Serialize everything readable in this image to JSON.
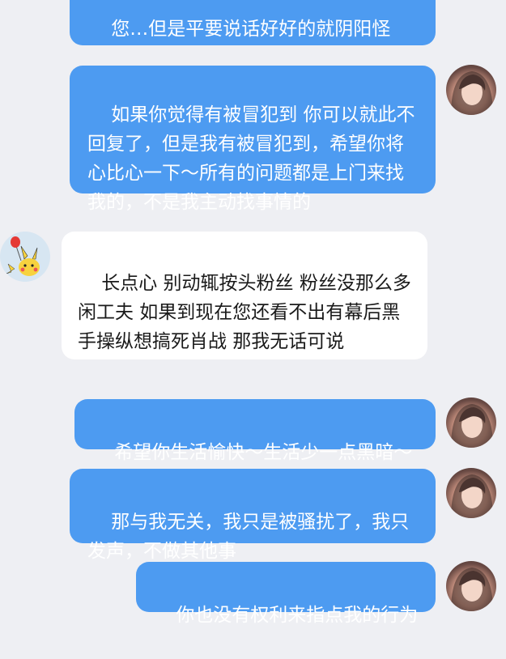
{
  "messages": [
    {
      "side": "out",
      "text": "您…但是平要说话好好的就阴阳怪气，挺让人不舒服的"
    },
    {
      "side": "out",
      "text": "如果你觉得有被冒犯到 你可以就此不回复了，但是我有被冒犯到，希望你将心比心一下～所有的问题都是上门来找我的，不是我主动找事情的"
    },
    {
      "side": "in",
      "text": "长点心 别动辄按头粉丝 粉丝没那么多闲工夫 如果到现在您还看不出有幕后黑手操纵想搞死肖战 那我无话可说"
    },
    {
      "side": "out",
      "text": "希望你生活愉快～生活少一点黑暗～"
    },
    {
      "side": "out",
      "text": "那与我无关，我只是被骚扰了，我只发声，不做其他事"
    },
    {
      "side": "out",
      "text": "你也没有权利来指点我的行为"
    }
  ],
  "avatars": {
    "user": "user-avatar-photo",
    "other": "pikachu-balloon-avatar"
  },
  "colors": {
    "background": "#eeeff3",
    "outgoing_bubble": "#4d9bf1",
    "incoming_bubble": "#ffffff"
  }
}
